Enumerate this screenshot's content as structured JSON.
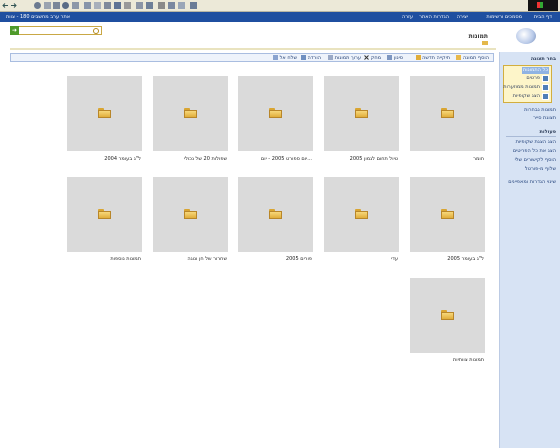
{
  "top_nav": {
    "site_title": "אתר ערב מחשבים 180 - צוות",
    "items": [
      "דף הבית",
      "מסמכים ורשימות",
      "יצירה",
      "הגדרות האתר",
      "עזרה"
    ]
  },
  "search": {
    "value": "",
    "placeholder": "",
    "go_label": "➜"
  },
  "page": {
    "title": "תמונות"
  },
  "toolbar": {
    "items": [
      "הוסף תמונה",
      "תיקייה חדשה",
      "סינון",
      "מחק",
      "ערוך תמונות",
      "הורדה",
      "שלח אל"
    ]
  },
  "sidebar": {
    "select_view_label": "בחר תצוגה",
    "all_pictures_label": "כל התמונות",
    "categories": [
      "פרטים",
      "תמונות ממוזערות",
      "הצג שקופיות"
    ],
    "view_links": [
      "תמונות נבחרות",
      "תצוגת סייר"
    ],
    "actions_heading": "פעולות",
    "actions": [
      "הצג הצגת שקופיות",
      "הצג את כל הפריטים",
      "הוסף לקישורים שלי",
      "שלוף מ-פורטל",
      "שינוי הגדרות ומאפיינים"
    ]
  },
  "gallery": {
    "folders": [
      "חומר",
      "טיול תחום לגמון 2005",
      "יום ספורט 2005 - יום...",
      "שפולות 20 של נכולי",
      "ל\"ג בעומר 2004",
      "ל\"ג בעומר 2005",
      "עדי",
      "פורים 2005",
      "שחרור של חן ונוגה",
      "תמונות נוספות",
      "תמונות צוותיות"
    ]
  },
  "colors": {
    "nav_blue": "#1f4fa0",
    "sidebar_bg": "#d7e3f4",
    "tile_bg": "#dadada",
    "folder": "#e0ad3b"
  }
}
